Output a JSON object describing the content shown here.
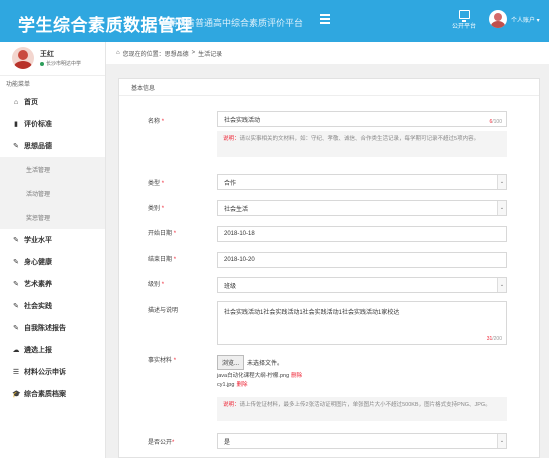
{
  "header": {
    "title": "学生综合素质数据管理",
    "subtitle": "湖南省普通高中综合素质评价平台",
    "platform_label": "公开平台",
    "user_menu_label": "个人账户 ▾"
  },
  "profile": {
    "name": "王红",
    "status": "长沙市明达中学"
  },
  "sidebar": {
    "caption": "功能菜单",
    "items": [
      {
        "label": "首页",
        "icon": "home-icon"
      },
      {
        "label": "评价标准",
        "icon": "book-icon"
      },
      {
        "label": "思想品德",
        "icon": "edit-icon"
      },
      {
        "label": "生活管理",
        "sub": true
      },
      {
        "label": "活动管理",
        "sub": true
      },
      {
        "label": "奖惩管理",
        "sub": true
      },
      {
        "label": "学业水平",
        "icon": "edit-icon"
      },
      {
        "label": "身心健康",
        "icon": "edit-icon"
      },
      {
        "label": "艺术素养",
        "icon": "edit-icon"
      },
      {
        "label": "社会实践",
        "icon": "edit-icon"
      },
      {
        "label": "自我陈述报告",
        "icon": "edit-icon"
      },
      {
        "label": "遴选上报",
        "icon": "cloud-icon"
      },
      {
        "label": "材料公示申诉",
        "icon": "list-icon"
      },
      {
        "label": "综合素质档案",
        "icon": "graduation-cap-icon"
      }
    ]
  },
  "breadcrumb": {
    "prefix": "您现在的位置：",
    "level1": "思想品德",
    "separator": ">",
    "level2": "生活记录"
  },
  "form": {
    "panel_title": "基本信息",
    "name_label": "名称",
    "name_value": "社会实践活动",
    "name_count_current": "6",
    "name_count_max": "/100",
    "name_hint_warn": "说明：",
    "name_hint": "请以实事相关的文材料，如：守纪、孝敬、诚信、合作类生活记录，每学期可记录不超过5项内容。",
    "type_label": "类型",
    "type_value": "合作",
    "category_label": "类别",
    "category_value": "社会生活",
    "start_label": "开始日期",
    "start_value": "2018-10-18",
    "end_label": "结束日期",
    "end_value": "2018-10-20",
    "level_label": "级别",
    "level_value": "班级",
    "desc_label": "描述与说明",
    "desc_value": "社会实践活动1社会实践活动1社会实践活动1社会实践活动1家校达",
    "desc_count_current": "31",
    "desc_count_max": "/200",
    "material_label": "事实材料",
    "file_button": "浏览...",
    "file_status": "未选择文件。",
    "file1": "java白动化课程大纲-柠檬.png",
    "file2": "cy1.jpg",
    "delete_label": "删除",
    "material_hint_warn": "说明：",
    "material_hint": "请上传佐证材料，最多上传2张活动证明图片，单张图片大小不超过500KB，图片格式支持PNG、JPG。",
    "public_label": "是否公开",
    "public_value": "是",
    "required_mark": "*"
  }
}
